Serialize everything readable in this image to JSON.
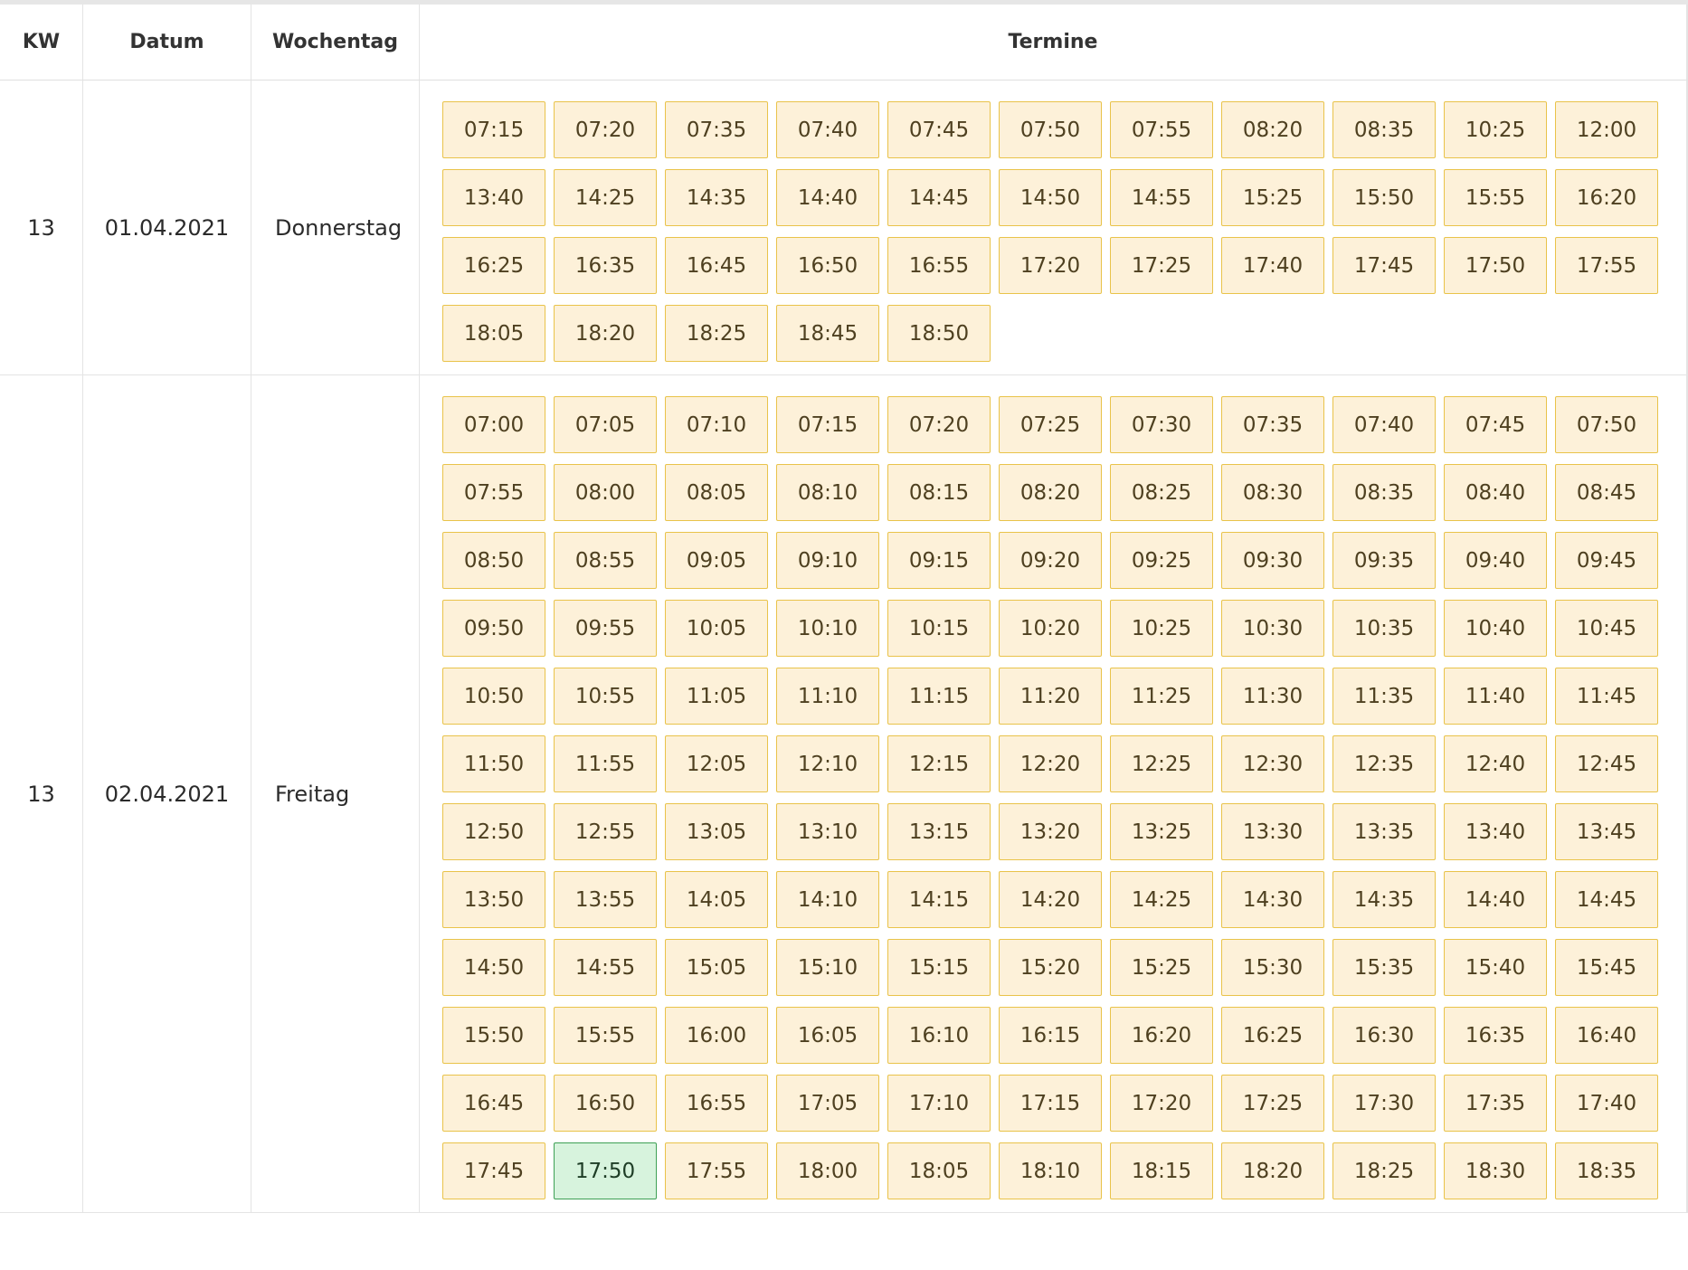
{
  "headers": {
    "kw": "KW",
    "datum": "Datum",
    "wochentag": "Wochentag",
    "termine": "Termine"
  },
  "rows": [
    {
      "kw": "13",
      "datum": "01.04.2021",
      "wochentag": "Donnerstag",
      "slots": [
        "07:15",
        "07:20",
        "07:35",
        "07:40",
        "07:45",
        "07:50",
        "07:55",
        "08:20",
        "08:35",
        "10:25",
        "12:00",
        "13:40",
        "14:25",
        "14:35",
        "14:40",
        "14:45",
        "14:50",
        "14:55",
        "15:25",
        "15:50",
        "15:55",
        "16:20",
        "16:25",
        "16:35",
        "16:45",
        "16:50",
        "16:55",
        "17:20",
        "17:25",
        "17:40",
        "17:45",
        "17:50",
        "17:55",
        "18:05",
        "18:20",
        "18:25",
        "18:45",
        "18:50"
      ]
    },
    {
      "kw": "13",
      "datum": "02.04.2021",
      "wochentag": "Freitag",
      "selected": "17:50",
      "slots": [
        "07:00",
        "07:05",
        "07:10",
        "07:15",
        "07:20",
        "07:25",
        "07:30",
        "07:35",
        "07:40",
        "07:45",
        "07:50",
        "07:55",
        "08:00",
        "08:05",
        "08:10",
        "08:15",
        "08:20",
        "08:25",
        "08:30",
        "08:35",
        "08:40",
        "08:45",
        "08:50",
        "08:55",
        "09:05",
        "09:10",
        "09:15",
        "09:20",
        "09:25",
        "09:30",
        "09:35",
        "09:40",
        "09:45",
        "09:50",
        "09:55",
        "10:05",
        "10:10",
        "10:15",
        "10:20",
        "10:25",
        "10:30",
        "10:35",
        "10:40",
        "10:45",
        "10:50",
        "10:55",
        "11:05",
        "11:10",
        "11:15",
        "11:20",
        "11:25",
        "11:30",
        "11:35",
        "11:40",
        "11:45",
        "11:50",
        "11:55",
        "12:05",
        "12:10",
        "12:15",
        "12:20",
        "12:25",
        "12:30",
        "12:35",
        "12:40",
        "12:45",
        "12:50",
        "12:55",
        "13:05",
        "13:10",
        "13:15",
        "13:20",
        "13:25",
        "13:30",
        "13:35",
        "13:40",
        "13:45",
        "13:50",
        "13:55",
        "14:05",
        "14:10",
        "14:15",
        "14:20",
        "14:25",
        "14:30",
        "14:35",
        "14:40",
        "14:45",
        "14:50",
        "14:55",
        "15:05",
        "15:10",
        "15:15",
        "15:20",
        "15:25",
        "15:30",
        "15:35",
        "15:40",
        "15:45",
        "15:50",
        "15:55",
        "16:00",
        "16:05",
        "16:10",
        "16:15",
        "16:20",
        "16:25",
        "16:30",
        "16:35",
        "16:40",
        "16:45",
        "16:50",
        "16:55",
        "17:05",
        "17:10",
        "17:15",
        "17:20",
        "17:25",
        "17:30",
        "17:35",
        "17:40",
        "17:45",
        "17:50",
        "17:55",
        "18:00",
        "18:05",
        "18:10",
        "18:15",
        "18:20",
        "18:25",
        "18:30",
        "18:35"
      ]
    }
  ],
  "colors": {
    "slot_bg": "#fdf1d9",
    "slot_border": "#e9c34a",
    "selected_bg": "#d7f3dd",
    "selected_border": "#3ea055"
  }
}
